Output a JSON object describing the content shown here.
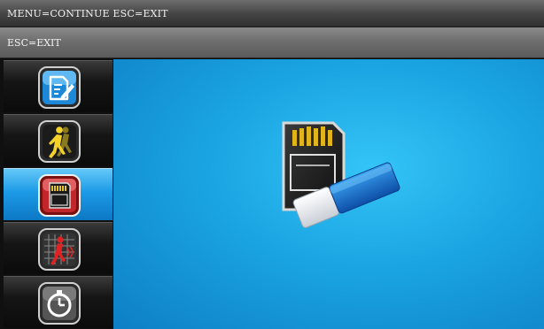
{
  "header": {
    "hint": "MENU=CONTINUE ESC=EXIT"
  },
  "subheader": {
    "hint": "ESC=EXIT"
  },
  "sidebar": {
    "items": [
      {
        "icon": "edit-note-icon"
      },
      {
        "icon": "motion-person-icon"
      },
      {
        "icon": "sd-card-icon",
        "selected": true
      },
      {
        "icon": "motion-grid-alarm-icon"
      },
      {
        "icon": "timer-icon"
      }
    ]
  },
  "main": {
    "icon": "sd-card-eraser-icon"
  },
  "colors": {
    "accent": "#1c9ae6",
    "background": "#22b4ee"
  }
}
